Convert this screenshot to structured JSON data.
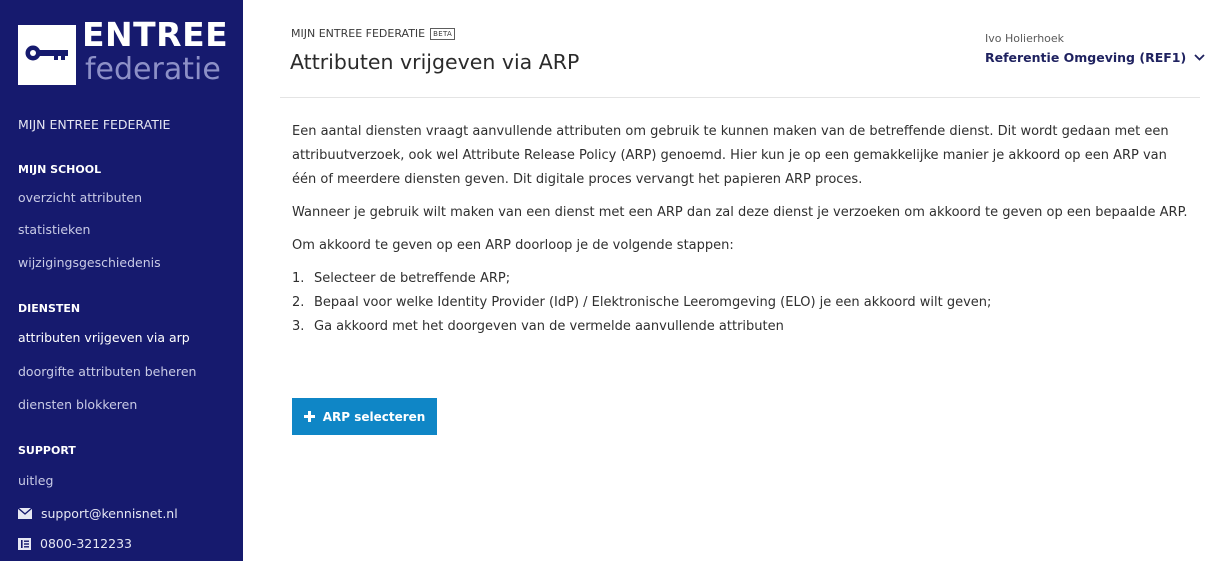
{
  "brand": {
    "title": "ENTREE",
    "subtitle": "federatie"
  },
  "sidebar": {
    "top_link": "MIJN ENTREE FEDERATIE",
    "sections": [
      {
        "heading": "MIJN SCHOOL",
        "items": [
          {
            "label": "overzicht attributen"
          },
          {
            "label": "statistieken"
          },
          {
            "label": "wijzigingsgeschiedenis"
          }
        ]
      },
      {
        "heading": "DIENSTEN",
        "items": [
          {
            "label": "attributen vrijgeven via arp",
            "active": true
          },
          {
            "label": "doorgifte attributen beheren"
          },
          {
            "label": "diensten blokkeren"
          }
        ]
      },
      {
        "heading": "SUPPORT",
        "items": [
          {
            "label": "uitleg"
          }
        ]
      }
    ],
    "contact": {
      "email": "support@kennisnet.nl",
      "email_icon": "mail-icon",
      "phone": "0800-3212233",
      "phone_icon": "phone-book-icon"
    }
  },
  "header": {
    "breadcrumb": "MIJN ENTREE FEDERATIE",
    "badge": "BETA",
    "title": "Attributen vrijgeven via ARP",
    "user_name": "Ivo Holierhoek",
    "environment": "Referentie Omgeving (REF1)"
  },
  "content": {
    "paragraphs": [
      "Een aantal diensten vraagt aanvullende attributen om gebruik te kunnen maken van de betreffende dienst. Dit wordt gedaan met een attribuutverzoek, ook wel Attribute Release Policy (ARP) genoemd. Hier kun je op een gemakkelijke manier je akkoord op een ARP van één of meerdere diensten geven. Dit digitale proces vervangt het papieren ARP proces.",
      "Wanneer je gebruik wilt maken van een dienst met een ARP dan zal deze dienst je verzoeken om akkoord te geven op een bepaalde ARP.",
      "Om akkoord te geven op een ARP doorloop je de volgende stappen:"
    ],
    "steps": [
      {
        "num": "1.",
        "text": "Selecteer de betreffende ARP;"
      },
      {
        "num": "2.",
        "text": "Bepaal voor welke Identity Provider (IdP) / Elektronische Leeromgeving (ELO) je een akkoord wilt geven;"
      },
      {
        "num": "3.",
        "text": "Ga akkoord met het doorgeven van de vermelde aanvullende attributen"
      }
    ],
    "button_label": "ARP selecteren"
  },
  "colors": {
    "sidebar_bg": "#161a6e",
    "accent": "#0f86c6",
    "env_text": "#1f2260"
  }
}
